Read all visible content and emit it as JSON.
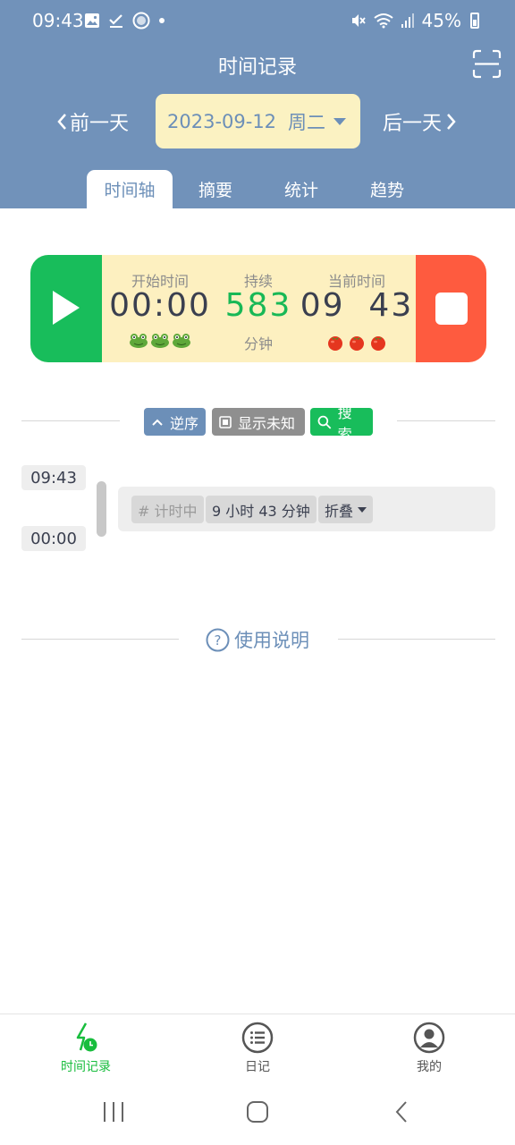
{
  "status_bar": {
    "time": "09:43",
    "battery": "45%"
  },
  "header": {
    "title": "时间记录",
    "prev_day": "前一天",
    "next_day": "后一天",
    "date": "2023-09-12",
    "weekday": "周二",
    "tabs": [
      "时间轴",
      "摘要",
      "统计",
      "趋势"
    ],
    "active_tab": "时间轴"
  },
  "timer": {
    "start_label": "开始时间",
    "start_value": "00:00",
    "duration_label": "持续",
    "duration_value": "583",
    "duration_unit": "分钟",
    "current_label": "当前时间",
    "current_value": "09  43",
    "frog_count": 3,
    "tomato_count": 3,
    "colors": {
      "play": "#18bd5b",
      "stop": "#fe5b3f",
      "panel": "#fdf0c0"
    }
  },
  "toolbar": {
    "reverse_label": "逆序",
    "show_unknown_label": "显示未知",
    "search_label": "搜索"
  },
  "timeline": {
    "end_time": "09:43",
    "start_time": "00:00",
    "entry": {
      "tag": "# 计时中",
      "duration": "9 小时 43 分钟",
      "fold_label": "折叠"
    }
  },
  "help_label": "使用说明",
  "bottom_nav": {
    "items": [
      {
        "label": "时间记录",
        "icon": "bolt-clock-icon",
        "active": true
      },
      {
        "label": "日记",
        "icon": "list-icon",
        "active": false
      },
      {
        "label": "我的",
        "icon": "user-icon",
        "active": false
      }
    ]
  },
  "accent_color": "#7192ba"
}
